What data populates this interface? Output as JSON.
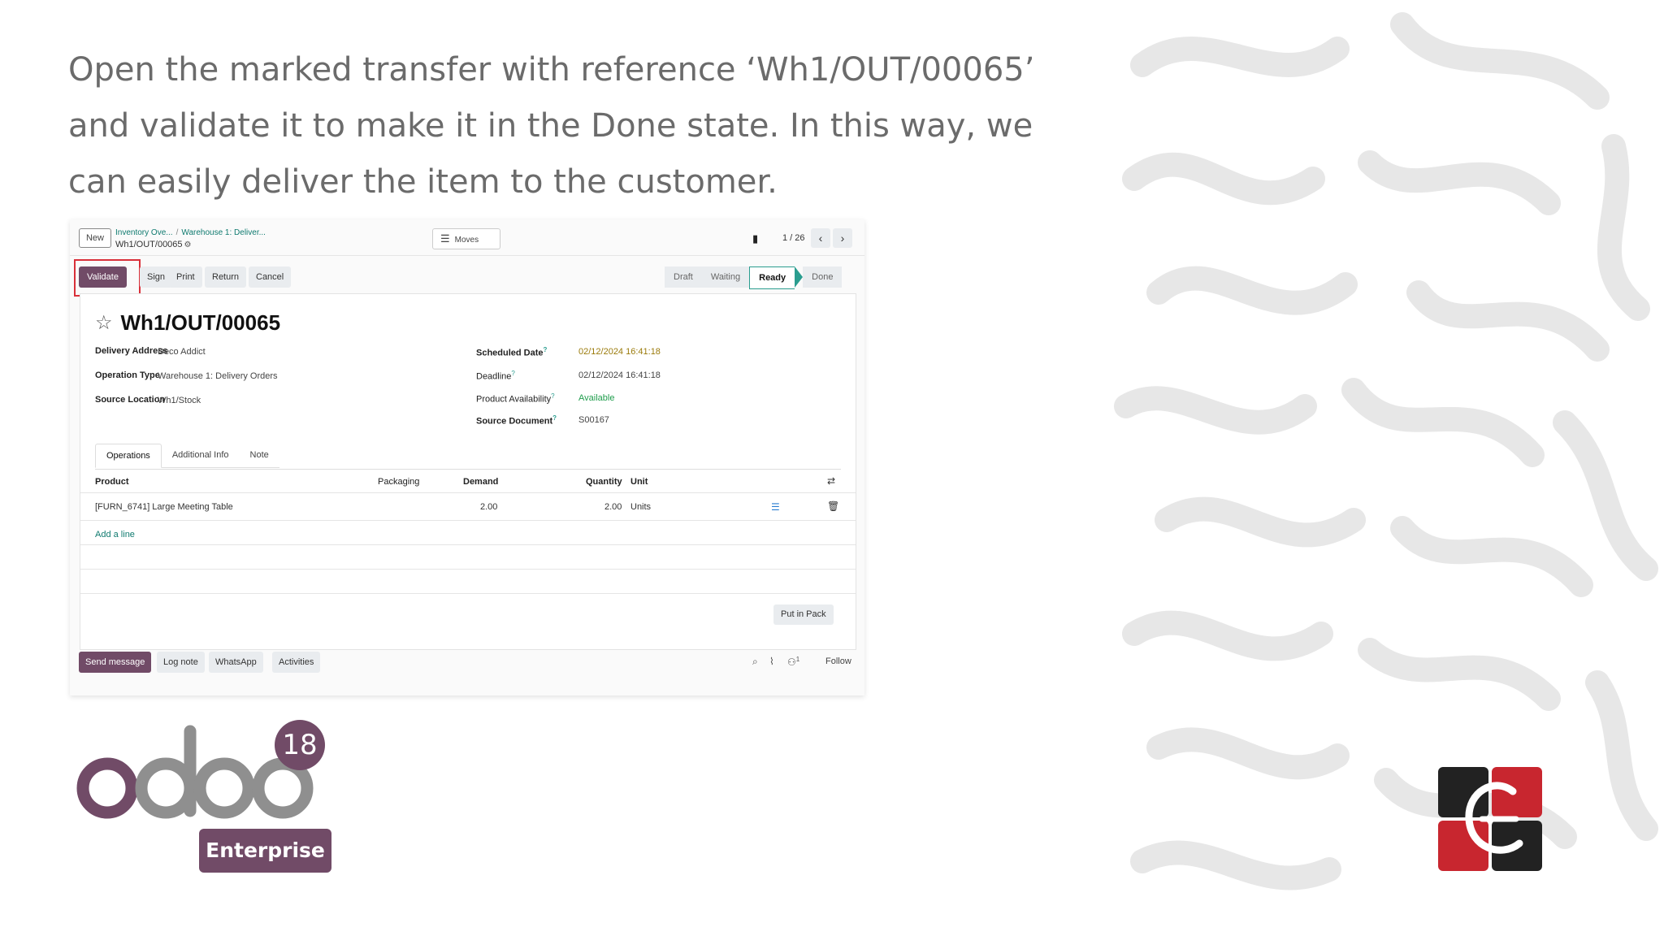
{
  "slide": {
    "instruction": "Open the marked transfer with reference ‘Wh1/OUT/00065’ and validate it to make it in the Done state. In this way, we can easily deliver the item to the customer."
  },
  "control_panel": {
    "new_label": "New",
    "breadcrumb_1": "Inventory Ove...",
    "breadcrumb_sep": "/",
    "breadcrumb_2": "Warehouse 1: Deliver...",
    "record_ref": "Wh1/OUT/00065",
    "moves_label": "Moves",
    "pager_value": "1 / 26"
  },
  "actions": {
    "validate": "Validate",
    "sign": "Sign",
    "print": "Print",
    "return": "Return",
    "cancel": "Cancel"
  },
  "statusbar": {
    "stages": [
      "Draft",
      "Waiting",
      "Ready",
      "Done"
    ],
    "active": "Ready"
  },
  "record": {
    "title": "Wh1/OUT/00065",
    "fields_left": [
      {
        "label": "Delivery Address",
        "value": "Deco Addict"
      },
      {
        "label": "Operation Type",
        "value": "Warehouse 1: Delivery Orders"
      },
      {
        "label": "Source Location",
        "value": "Wh1/Stock"
      }
    ],
    "fields_right": [
      {
        "label": "Scheduled Date",
        "value": "02/12/2024 16:41:18"
      },
      {
        "label": "Deadline",
        "value": "02/12/2024 16:41:18"
      },
      {
        "label": "Product Availability",
        "value": "Available"
      },
      {
        "label": "Source Document",
        "value": "S00167"
      }
    ],
    "help_mark": "?"
  },
  "tabs": [
    "Operations",
    "Additional Info",
    "Note"
  ],
  "operations": {
    "columns": [
      "Product",
      "Packaging",
      "Demand",
      "Quantity",
      "Unit"
    ],
    "rows": [
      {
        "product": "[FURN_6741] Large Meeting Table",
        "packaging": "",
        "demand": "2.00",
        "quantity": "2.00",
        "unit": "Units"
      }
    ],
    "add_line": "Add a line",
    "put_in_pack": "Put in Pack"
  },
  "chatter": {
    "send_message": "Send message",
    "log_note": "Log note",
    "whatsapp": "WhatsApp",
    "activities": "Activities",
    "follower_count": "1",
    "follow": "Follow"
  },
  "branding": {
    "odoo_version": "18",
    "edition": "Enterprise",
    "accent": "#714b67",
    "highlight": "#d9303a"
  }
}
